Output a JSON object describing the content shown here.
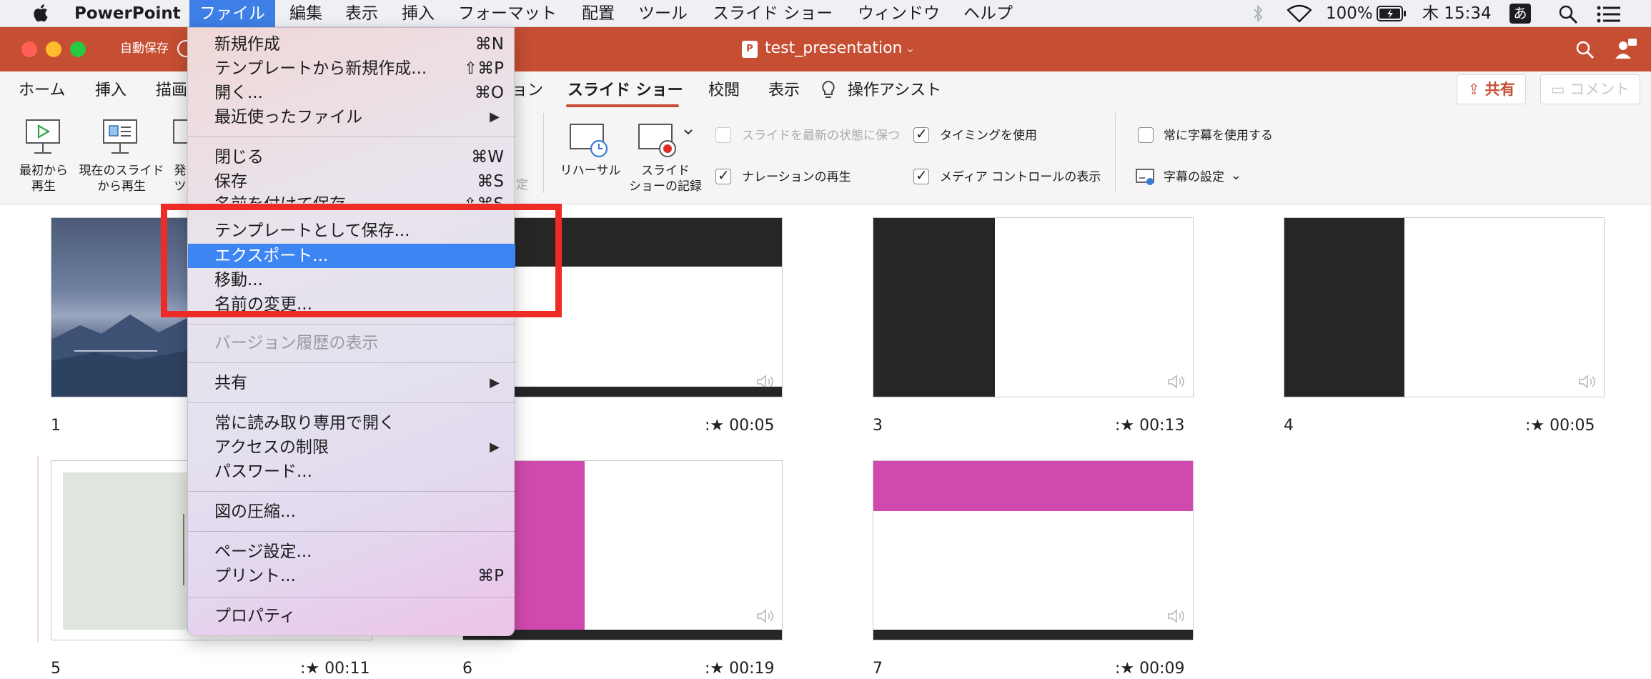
{
  "menubar": {
    "app_name": "PowerPoint",
    "items": [
      "ファイル",
      "編集",
      "表示",
      "挿入",
      "フォーマット",
      "配置",
      "ツール",
      "スライド ショー",
      "ウィンドウ",
      "ヘルプ"
    ],
    "battery": "100%",
    "clock": "木 15:34",
    "input_method": "あ"
  },
  "titlebar": {
    "autosave_label": "自動保存",
    "doc_title": "test_presentation",
    "colors": {
      "titlebar": "#c64e32",
      "close": "#ff5f57",
      "minimize": "#febc2e",
      "zoom": "#28c840"
    }
  },
  "ribbon": {
    "tabs": [
      "ホーム",
      "挿入",
      "描画",
      "ョン",
      "スライド ショー",
      "校閲",
      "表示",
      "操作アシスト"
    ],
    "active_tab": "スライド ショー",
    "share_label": "共有",
    "comment_label": "コメント",
    "buttons": {
      "from_start": [
        "最初から",
        "再生"
      ],
      "from_current": [
        "現在のスライド",
        "から再生"
      ],
      "partial": [
        "発",
        "ツ"
      ],
      "rehearse": "リハーサル",
      "record": [
        "スライド",
        "ショーの記録"
      ],
      "caption_settings": "字幕の設定"
    },
    "partial_group_text": "定",
    "checkboxes": [
      {
        "label": "スライドを最新の状態に保つ",
        "checked": false,
        "disabled": true
      },
      {
        "label": "タイミングを使用",
        "checked": true,
        "disabled": false
      },
      {
        "label": "ナレーションの再生",
        "checked": true,
        "disabled": false
      },
      {
        "label": "メディア コントロールの表示",
        "checked": true,
        "disabled": false
      },
      {
        "label": "常に字幕を使用する",
        "checked": false,
        "disabled": false
      }
    ]
  },
  "slides": [
    {
      "number": "1",
      "time": ""
    },
    {
      "number": "",
      "time": "00:05"
    },
    {
      "number": "3",
      "time": "00:13"
    },
    {
      "number": "4",
      "time": "00:05"
    },
    {
      "number": "5",
      "time": "00:11"
    },
    {
      "number": "6",
      "time": "00:19"
    },
    {
      "number": "7",
      "time": "00:09"
    }
  ],
  "slide_colors": {
    "dark": "#262626",
    "magenta": "#d04aad",
    "sage": "#e0e6df"
  },
  "file_menu": {
    "items": [
      {
        "label": "新規作成",
        "shortcut": "⌘N"
      },
      {
        "label": "テンプレートから新規作成...",
        "shortcut": "⇧⌘P"
      },
      {
        "label": "開く...",
        "shortcut": "⌘O"
      },
      {
        "label": "最近使ったファイル",
        "shortcut": ""
      },
      {
        "label": "閉じる",
        "shortcut": "⌘W"
      },
      {
        "label": "保存",
        "shortcut": "⌘S"
      },
      {
        "label": "名前を付けて保存...",
        "shortcut": "⇧⌘S"
      },
      {
        "label": "テンプレートとして保存...",
        "shortcut": ""
      },
      {
        "label": "エクスポート...",
        "shortcut": ""
      },
      {
        "label": "移動...",
        "shortcut": ""
      },
      {
        "label": "名前の変更...",
        "shortcut": ""
      },
      {
        "label": "バージョン履歴の表示",
        "shortcut": ""
      },
      {
        "label": "共有",
        "shortcut": ""
      },
      {
        "label": "常に読み取り専用で開く",
        "shortcut": ""
      },
      {
        "label": "アクセスの制限",
        "shortcut": ""
      },
      {
        "label": "パスワード...",
        "shortcut": ""
      },
      {
        "label": "図の圧縮...",
        "shortcut": ""
      },
      {
        "label": "ページ設定...",
        "shortcut": ""
      },
      {
        "label": "プリント...",
        "shortcut": "⌘P"
      },
      {
        "label": "プロパティ",
        "shortcut": ""
      }
    ],
    "highlight_color": "#3d85f2"
  },
  "annotation_color": "#ee2b24"
}
